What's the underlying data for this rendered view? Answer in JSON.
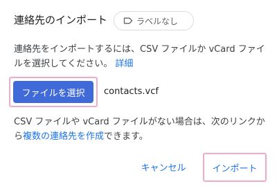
{
  "dialog": {
    "title": "連絡先のインポート",
    "label_chip": "ラベルなし",
    "label_icon": "label-outline-icon",
    "description": "連絡先をインポートするには、CSV ファイルか vCard ファイルを選択してください。",
    "details_link": "詳細",
    "select_file_button": "ファイルを選択",
    "selected_file_name": "contacts.vcf",
    "note_before": "CSV ファイルや vCard ファイルがない場合は、次のリンクから",
    "note_link": "複数の連絡先を作成",
    "note_after": "できます。",
    "cancel_button": "キャンセル",
    "import_button": "インポート"
  },
  "colors": {
    "primary_button": "#3f6ad8",
    "link": "#1a73e8",
    "highlight_outline": "#f0aac9",
    "text": "#202124"
  }
}
